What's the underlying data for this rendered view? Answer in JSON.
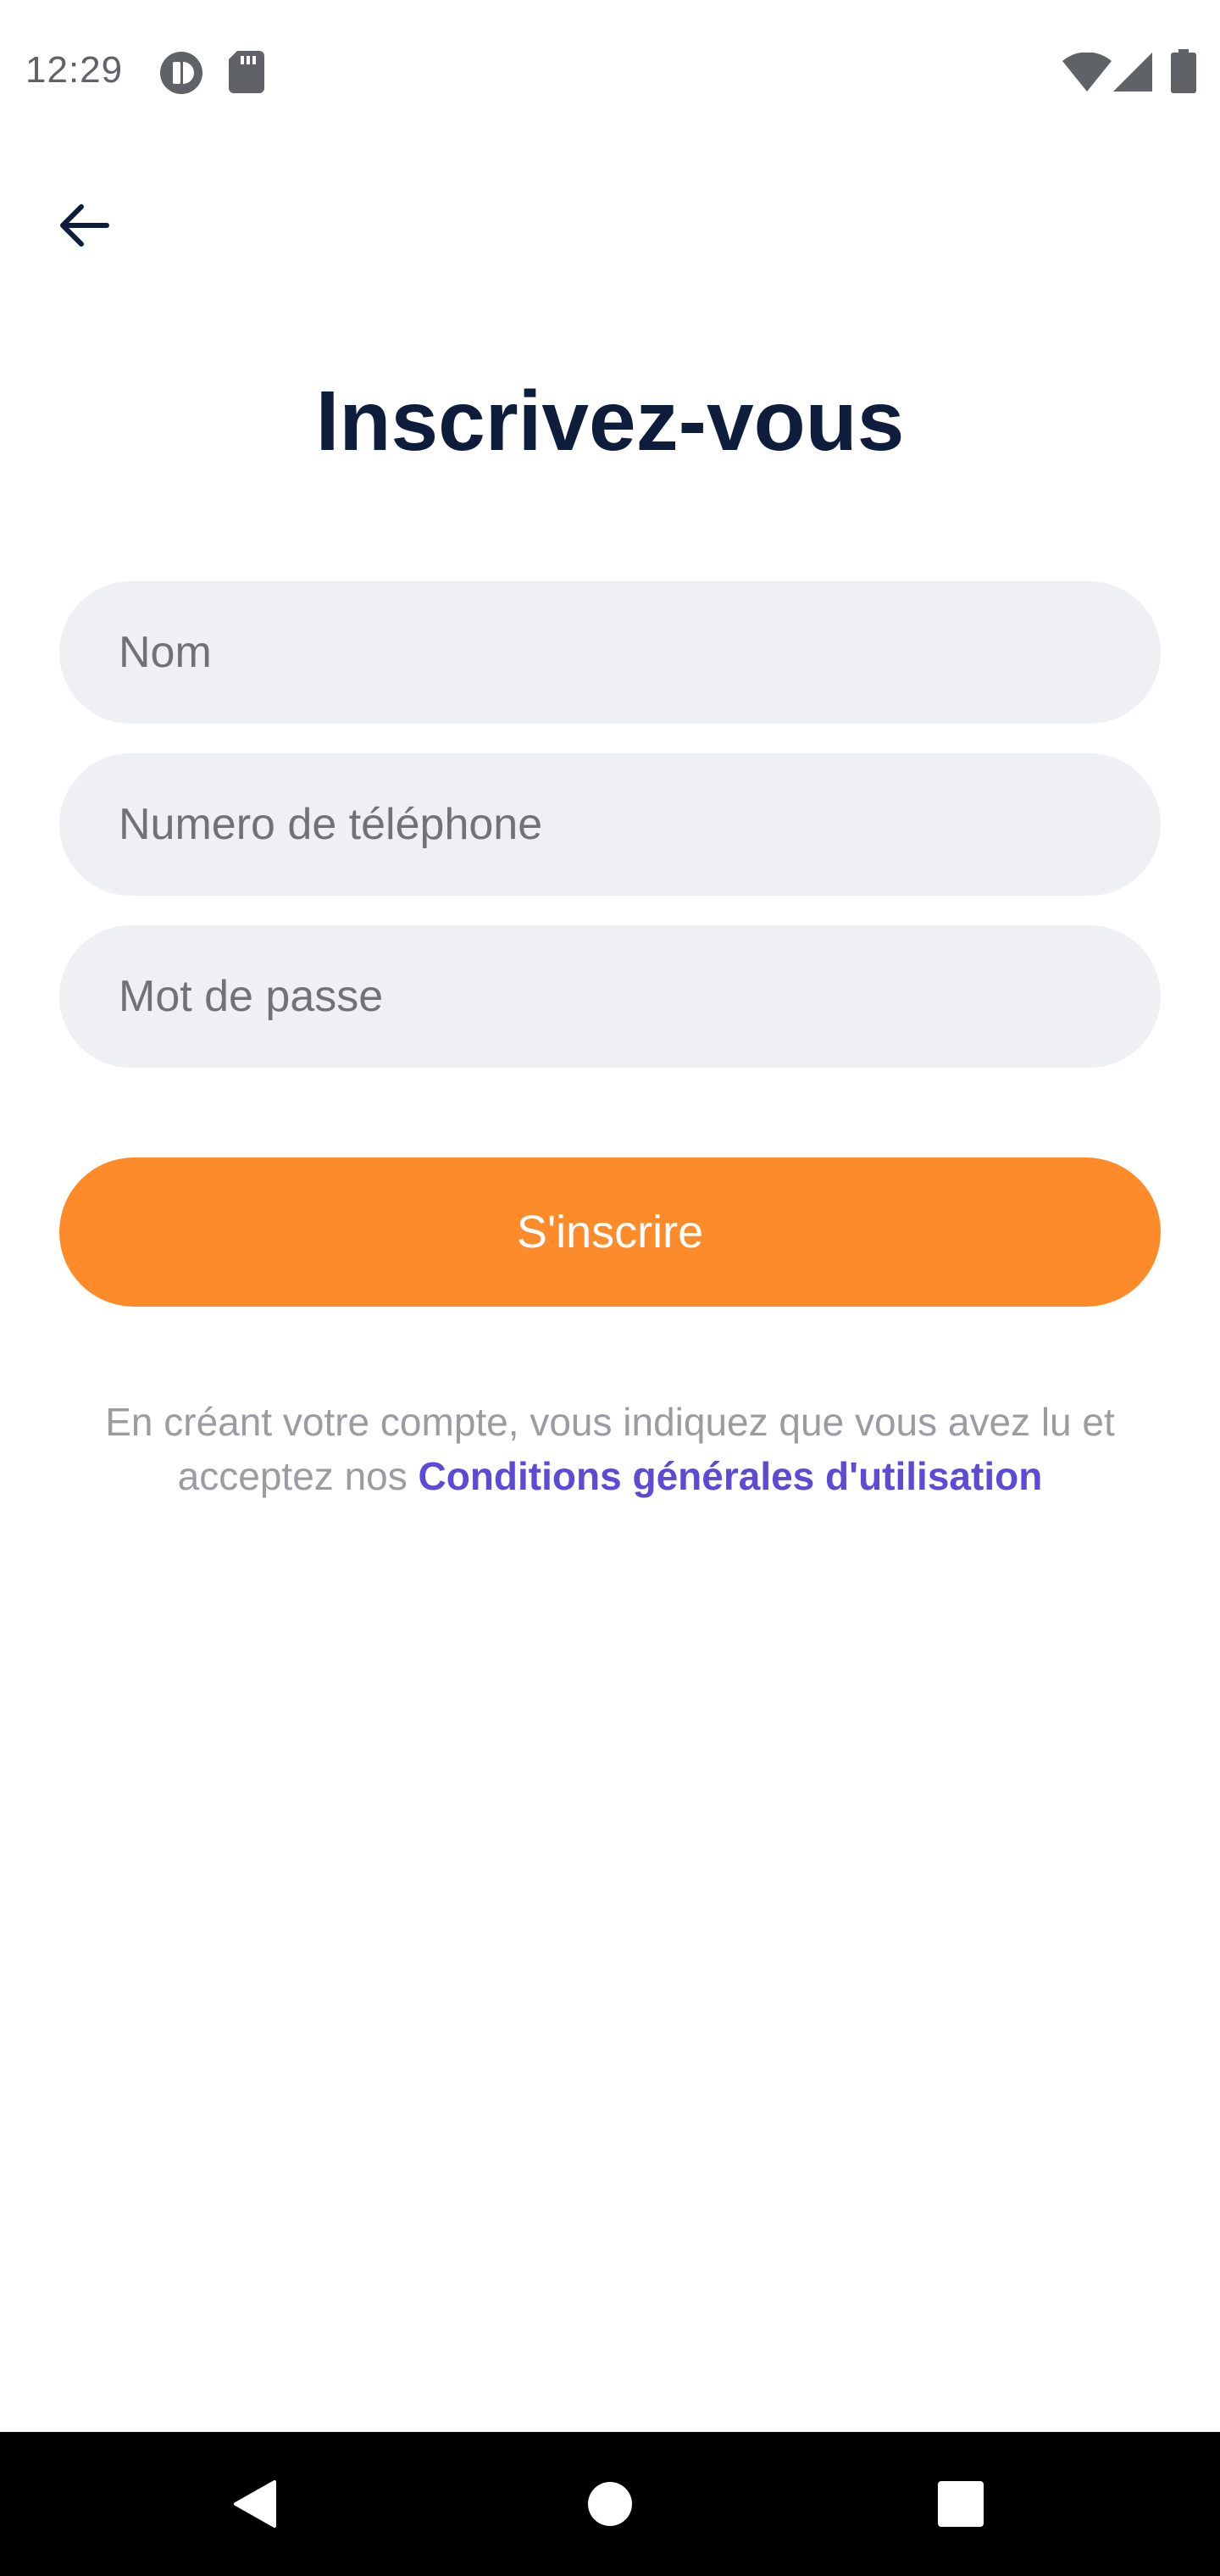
{
  "status_bar": {
    "time": "12:29",
    "icons": [
      "app-circle-icon",
      "sd-card-icon",
      "wifi-icon",
      "cell-signal-icon",
      "battery-icon"
    ]
  },
  "header": {
    "back_icon": "arrow-left-icon"
  },
  "main": {
    "title": "Inscrivez-vous",
    "fields": {
      "name_placeholder": "Nom",
      "phone_placeholder": "Numero de téléphone",
      "password_placeholder": "Mot de passe"
    },
    "submit_label": "S'inscrire",
    "terms": {
      "text_line": "En créant votre compte, vous indiquez que vous avez lu et acceptez nos ",
      "link_label": "Conditions générales d'utilisation"
    }
  },
  "colors": {
    "title": "#0f1d3d",
    "input_bg": "#eff0f3",
    "accent_orange": "#fd8b2a",
    "link_purple": "#5b4bd6"
  },
  "nav_bar": {
    "buttons": [
      "back-triangle-icon",
      "home-circle-icon",
      "recents-square-icon"
    ]
  }
}
